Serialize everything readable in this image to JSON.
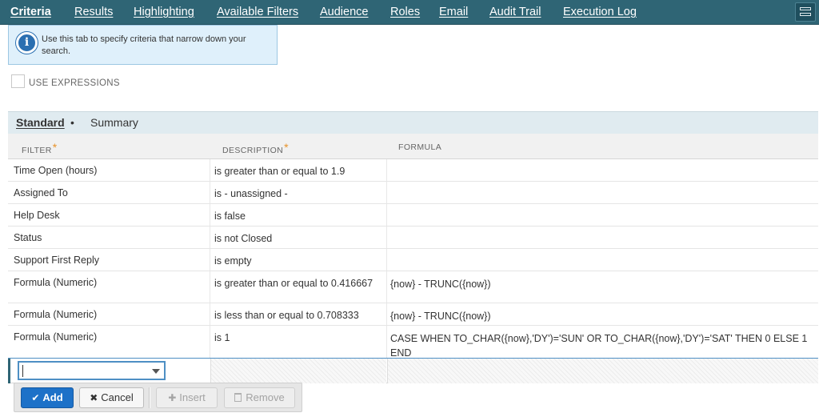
{
  "tabs": [
    {
      "label": "Criteria",
      "active": true
    },
    {
      "label": "Results",
      "active": false
    },
    {
      "label": "Highlighting",
      "active": false
    },
    {
      "label": "Available Filters",
      "active": false
    },
    {
      "label": "Audience",
      "active": false
    },
    {
      "label": "Roles",
      "active": false
    },
    {
      "label": "Email",
      "active": false
    },
    {
      "label": "Audit Trail",
      "active": false
    },
    {
      "label": "Execution Log",
      "active": false
    }
  ],
  "info": {
    "icon": "info-icon",
    "text": "Use this tab to specify criteria that narrow down your search."
  },
  "use_expressions": {
    "label": "USE EXPRESSIONS",
    "checked": false
  },
  "subtabs": {
    "standard": "Standard",
    "dot": "•",
    "summary": "Summary"
  },
  "table": {
    "headers": {
      "filter": "FILTER",
      "description": "DESCRIPTION",
      "formula": "FORMULA",
      "required_mark": "*"
    },
    "rows": [
      {
        "filter": "Time Open (hours)",
        "description": "is greater than or equal to 1.9",
        "formula": ""
      },
      {
        "filter": "Assigned To",
        "description": "is - unassigned -",
        "formula": ""
      },
      {
        "filter": "Help Desk",
        "description": "is false",
        "formula": ""
      },
      {
        "filter": "Status",
        "description": "is not Closed",
        "formula": ""
      },
      {
        "filter": "Support First Reply",
        "description": "is empty",
        "formula": ""
      },
      {
        "filter": "Formula (Numeric)",
        "description": "is greater than or equal to 0.416667",
        "formula": "{now} - TRUNC({now})"
      },
      {
        "filter": "Formula (Numeric)",
        "description": "is less than or equal to 0.708333",
        "formula": "{now} - TRUNC({now})"
      },
      {
        "filter": "Formula (Numeric)",
        "description": "is 1",
        "formula": "CASE WHEN TO_CHAR({now},'DY')='SUN' OR TO_CHAR({now},'DY')='SAT' THEN 0 ELSE 1 END"
      }
    ],
    "new_filter_value": ""
  },
  "buttons": {
    "add": "Add",
    "cancel": "Cancel",
    "insert": "Insert",
    "remove": "Remove"
  },
  "colors": {
    "topbar": "#2f6575",
    "primary_button": "#1d71c8",
    "required_mark": "#e8932a"
  }
}
